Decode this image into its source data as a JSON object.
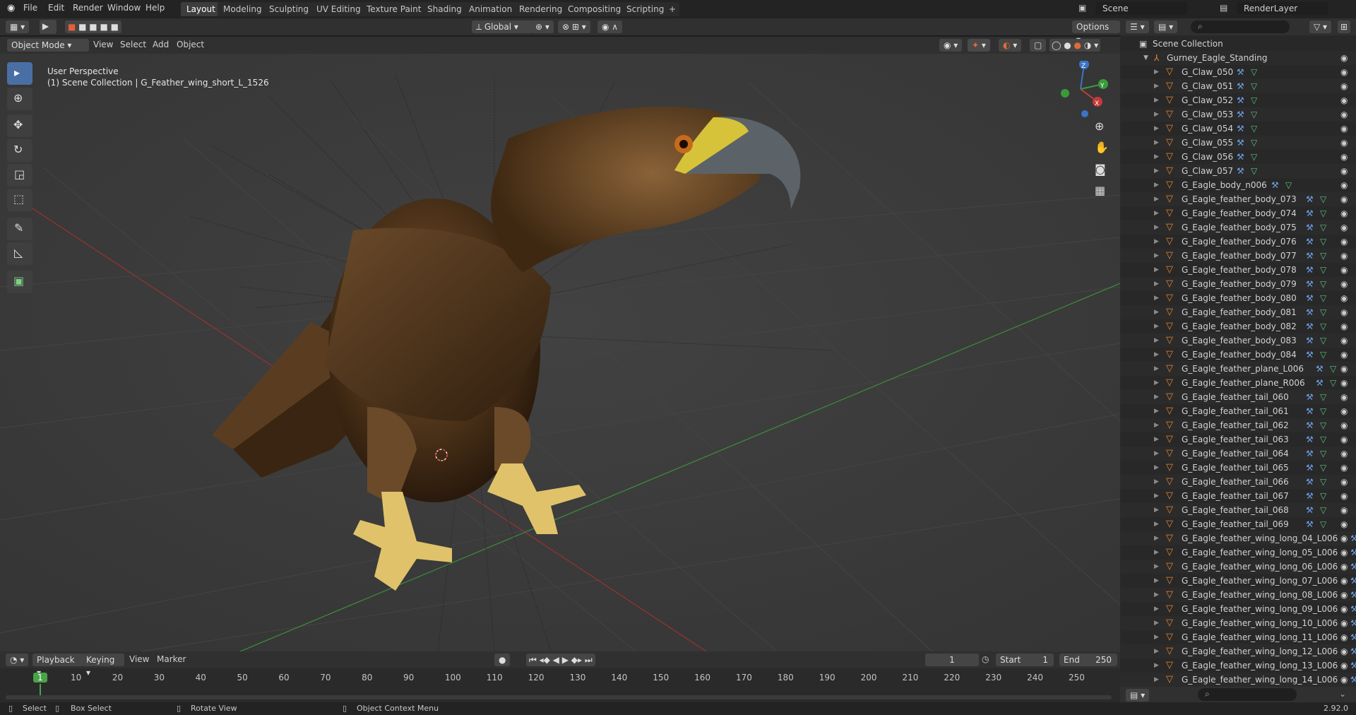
{
  "topbar": {
    "menus": [
      "File",
      "Edit",
      "Render",
      "Window",
      "Help"
    ],
    "workspaces": [
      "Layout",
      "Modeling",
      "Sculpting",
      "UV Editing",
      "Texture Paint",
      "Shading",
      "Animation",
      "Rendering",
      "Compositing",
      "Scripting"
    ],
    "active_workspace": "Layout",
    "add_tab": "+",
    "scene_label": "Scene",
    "view_layer_label": "RenderLayer"
  },
  "viewport_header": {
    "mode": "Object Mode",
    "menus": [
      "View",
      "Select",
      "Add",
      "Object"
    ],
    "orientation": "Global",
    "options": "Options"
  },
  "viewport": {
    "perspective": "User Perspective",
    "collection_info": "(1) Scene Collection | G_Feather_wing_short_L_1526",
    "gizmo_axes": [
      "Z",
      "Y",
      "X"
    ]
  },
  "outliner": {
    "root": "Scene Collection",
    "collection": "Gurney_Eagle_Standing",
    "items": [
      "G_Claw_050",
      "G_Claw_051",
      "G_Claw_052",
      "G_Claw_053",
      "G_Claw_054",
      "G_Claw_055",
      "G_Claw_056",
      "G_Claw_057",
      "G_Eagle_body_n006",
      "G_Eagle_feather_body_073",
      "G_Eagle_feather_body_074",
      "G_Eagle_feather_body_075",
      "G_Eagle_feather_body_076",
      "G_Eagle_feather_body_077",
      "G_Eagle_feather_body_078",
      "G_Eagle_feather_body_079",
      "G_Eagle_feather_body_080",
      "G_Eagle_feather_body_081",
      "G_Eagle_feather_body_082",
      "G_Eagle_feather_body_083",
      "G_Eagle_feather_body_084",
      "G_Eagle_feather_plane_L006",
      "G_Eagle_feather_plane_R006",
      "G_Eagle_feather_tail_060",
      "G_Eagle_feather_tail_061",
      "G_Eagle_feather_tail_062",
      "G_Eagle_feather_tail_063",
      "G_Eagle_feather_tail_064",
      "G_Eagle_feather_tail_065",
      "G_Eagle_feather_tail_066",
      "G_Eagle_feather_tail_067",
      "G_Eagle_feather_tail_068",
      "G_Eagle_feather_tail_069",
      "G_Eagle_feather_wing_long_04_L006",
      "G_Eagle_feather_wing_long_05_L006",
      "G_Eagle_feather_wing_long_06_L006",
      "G_Eagle_feather_wing_long_07_L006",
      "G_Eagle_feather_wing_long_08_L006",
      "G_Eagle_feather_wing_long_09_L006",
      "G_Eagle_feather_wing_long_10_L006",
      "G_Eagle_feather_wing_long_11_L006",
      "G_Eagle_feather_wing_long_12_L006",
      "G_Eagle_feather_wing_long_13_L006",
      "G_Eagle_feather_wing_long_14_L006"
    ]
  },
  "timeline": {
    "menus": [
      "Playback",
      "Keying",
      "View",
      "Marker"
    ],
    "current_frame": "1",
    "start_label": "Start",
    "start_value": "1",
    "end_label": "End",
    "end_value": "250",
    "ticks": [
      "1",
      "10",
      "20",
      "30",
      "40",
      "50",
      "60",
      "70",
      "80",
      "90",
      "100",
      "110",
      "120",
      "130",
      "140",
      "150",
      "160",
      "170",
      "180",
      "190",
      "200",
      "210",
      "220",
      "230",
      "240",
      "250"
    ]
  },
  "statusbar": {
    "select": "Select",
    "box_select": "Box Select",
    "rotate_view": "Rotate View",
    "context_menu": "Object Context Menu",
    "version": "2.92.0"
  },
  "colors": {
    "accent": "#4a6fa5",
    "mesh_icon": "#e8872c",
    "frame_marker": "#4aa34a",
    "x_axis": "#a03030",
    "y_axis": "#3c8f3c"
  }
}
